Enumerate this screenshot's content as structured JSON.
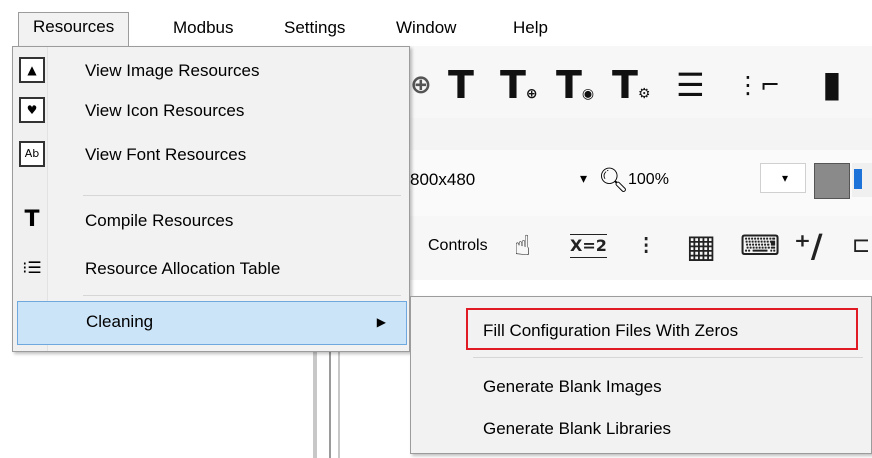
{
  "menubar": {
    "items": [
      {
        "label": "Resources",
        "active": true
      },
      {
        "label": "Modbus"
      },
      {
        "label": "Settings"
      },
      {
        "label": "Window"
      },
      {
        "label": "Help"
      }
    ]
  },
  "resources_menu": {
    "items": [
      {
        "label": "View Image Resources",
        "icon": "image-resource-icon"
      },
      {
        "label": "View Icon Resources",
        "icon": "icon-resource-icon"
      },
      {
        "label": "View Font Resources",
        "icon": "font-resource-icon"
      },
      {
        "label": "Compile Resources",
        "icon": "compile-icon"
      },
      {
        "label": "Resource Allocation Table",
        "icon": "allocation-table-icon"
      },
      {
        "label": "Cleaning",
        "has_submenu": true,
        "highlighted": true
      }
    ],
    "font_icon_text": "Ab"
  },
  "cleaning_submenu": {
    "items": [
      {
        "label": "Fill Configuration Files With Zeros",
        "outlined": true
      },
      {
        "label": "Generate Blank Images"
      },
      {
        "label": "Generate Blank Libraries"
      }
    ]
  },
  "background": {
    "resolution_value": "800x480",
    "zoom_value": "100%",
    "controls_label": "Controls",
    "expression_icon_text": "X=2"
  },
  "colors": {
    "highlight_bg": "#cce4f7",
    "highlight_border": "#6fa8dc",
    "outline_red": "#e01b24",
    "color_swatch": "#8a8a8a",
    "accent_blue": "#1e73d8"
  }
}
